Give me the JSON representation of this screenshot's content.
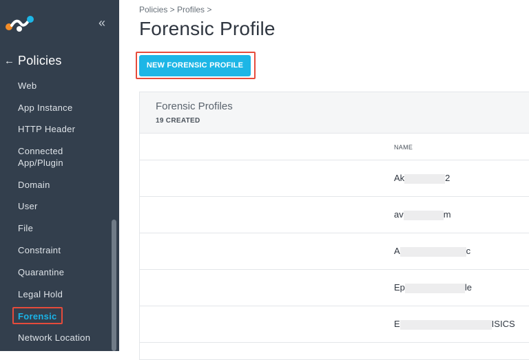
{
  "sidebar": {
    "collapse_glyph": "«",
    "back_glyph": "←",
    "title": "Policies",
    "items": [
      {
        "label": "Web"
      },
      {
        "label": "App Instance"
      },
      {
        "label": "HTTP Header"
      },
      {
        "label": "Connected App/Plugin"
      },
      {
        "label": "Domain"
      },
      {
        "label": "User"
      },
      {
        "label": "File"
      },
      {
        "label": "Constraint"
      },
      {
        "label": "Quarantine"
      },
      {
        "label": "Legal Hold"
      },
      {
        "label": "Forensic",
        "active": true
      },
      {
        "label": "Network Location"
      }
    ]
  },
  "main": {
    "breadcrumb": "Policies > Profiles >",
    "title": "Forensic Profile",
    "new_button_label": "NEW FORENSIC PROFILE",
    "card": {
      "title": "Forensic Profiles",
      "count": "19 CREATED",
      "column_name": "NAME",
      "rows": [
        {
          "prefix": "Ak",
          "suffix": "2"
        },
        {
          "prefix": "av",
          "suffix": "m"
        },
        {
          "prefix": "A",
          "suffix": "c"
        },
        {
          "prefix": "Ep",
          "suffix": "le"
        },
        {
          "prefix": "E",
          "suffix": "ISICS"
        }
      ]
    }
  },
  "colors": {
    "sidebar_bg": "#333f4d",
    "accent": "#1db6e6",
    "highlight_border": "#e64b3b"
  }
}
